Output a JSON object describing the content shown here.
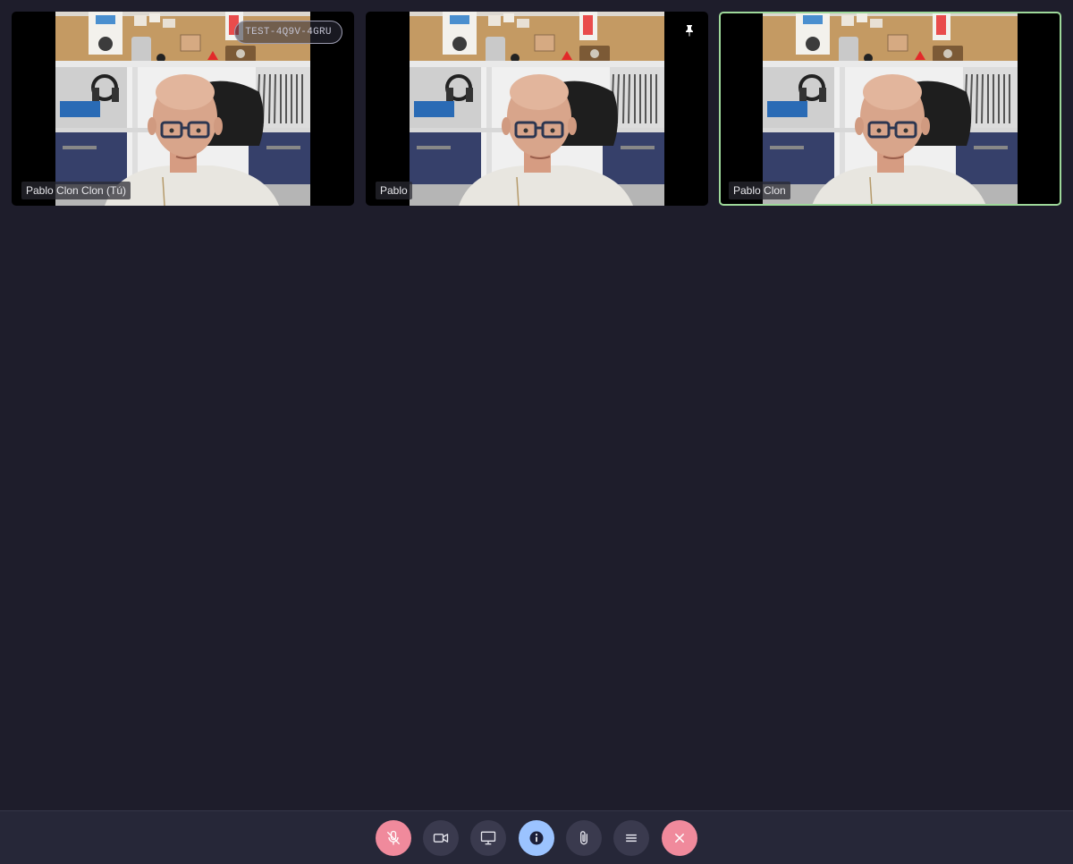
{
  "conference": {
    "room_code": "TEST-4Q9V-4GRU",
    "participants": [
      {
        "name": "Pablo Clon Clon (Tú)",
        "is_local": true,
        "has_room_badge": true,
        "pinned": false,
        "active_speaker": false
      },
      {
        "name": "Pablo",
        "is_local": false,
        "has_room_badge": false,
        "pinned": true,
        "active_speaker": false
      },
      {
        "name": "Pablo Clon",
        "is_local": false,
        "has_room_badge": false,
        "pinned": false,
        "active_speaker": true
      }
    ]
  },
  "toolbar": {
    "buttons": [
      {
        "icon": "mic-off-icon",
        "state": "muted",
        "color": "#f08a9c"
      },
      {
        "icon": "video-camera-icon",
        "state": "on"
      },
      {
        "icon": "screen-share-icon",
        "state": "off"
      },
      {
        "icon": "info-icon",
        "state": "active",
        "color": "#9bc3ff"
      },
      {
        "icon": "paperclip-icon",
        "state": "off"
      },
      {
        "icon": "menu-icon",
        "state": "off"
      },
      {
        "icon": "hang-up-icon",
        "state": "danger",
        "color": "#f08a9c"
      }
    ]
  },
  "colors": {
    "background": "#1e1d2b",
    "toolbar": "#262738",
    "active_speaker_border": "#9ed89a"
  }
}
